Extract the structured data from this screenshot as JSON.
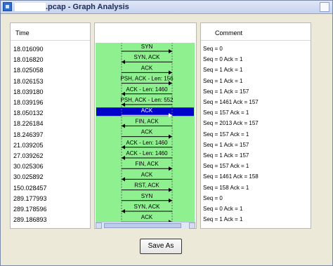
{
  "window": {
    "title": ".pcap - Graph Analysis"
  },
  "columns": {
    "time_header": "Time",
    "comment_header": "Comment"
  },
  "rows": [
    {
      "time": "18.016090",
      "label": "SYN",
      "dir": "right",
      "comment": "Seq = 0",
      "selected": false
    },
    {
      "time": "18.016820",
      "label": "SYN, ACK",
      "dir": "left",
      "comment": "Seq = 0 Ack = 1",
      "selected": false
    },
    {
      "time": "18.025058",
      "label": "ACK",
      "dir": "right",
      "comment": "Seq = 1 Ack = 1",
      "selected": false
    },
    {
      "time": "18.026153",
      "label": "PSH, ACK - Len: 156",
      "dir": "right",
      "comment": "Seq = 1 Ack = 1",
      "selected": false
    },
    {
      "time": "18.039180",
      "label": "ACK - Len: 1460",
      "dir": "left",
      "comment": "Seq = 1 Ack = 157",
      "selected": false
    },
    {
      "time": "18.039196",
      "label": "PSH, ACK - Len: 552",
      "dir": "left",
      "comment": "Seq = 1461 Ack = 157",
      "selected": false
    },
    {
      "time": "18.050132",
      "label": "ACK",
      "dir": "right",
      "comment": "Seq = 157 Ack = 1",
      "selected": true
    },
    {
      "time": "18.226184",
      "label": "FIN, ACK",
      "dir": "left",
      "comment": "Seq = 2013 Ack = 157",
      "selected": false
    },
    {
      "time": "18.246397",
      "label": "ACK",
      "dir": "right",
      "comment": "Seq = 157 Ack = 1",
      "selected": false
    },
    {
      "time": "21.039205",
      "label": "ACK - Len: 1460",
      "dir": "left",
      "comment": "Seq = 1 Ack = 157",
      "selected": false
    },
    {
      "time": "27.039262",
      "label": "ACK - Len: 1460",
      "dir": "left",
      "comment": "Seq = 1 Ack = 157",
      "selected": false
    },
    {
      "time": "30.025306",
      "label": "FIN, ACK",
      "dir": "right",
      "comment": "Seq = 157 Ack = 1",
      "selected": false
    },
    {
      "time": "30.025892",
      "label": "ACK",
      "dir": "left",
      "comment": "Seq = 1461 Ack = 158",
      "selected": false
    },
    {
      "time": "150.028457",
      "label": "RST, ACK",
      "dir": "right",
      "comment": "Seq = 158 Ack = 1",
      "selected": false
    },
    {
      "time": "289.177993",
      "label": "SYN",
      "dir": "right",
      "comment": "Seq = 0",
      "selected": false
    },
    {
      "time": "289.178596",
      "label": "SYN, ACK",
      "dir": "left",
      "comment": "Seq = 0 Ack = 1",
      "selected": false
    },
    {
      "time": "289.186893",
      "label": "ACK",
      "dir": "right",
      "comment": "Seq = 1 Ack = 1",
      "selected": false
    }
  ],
  "buttons": {
    "save_as": "Save As"
  },
  "colors": {
    "graph_bg": "#8ff08f",
    "selected": "#0000cc"
  }
}
